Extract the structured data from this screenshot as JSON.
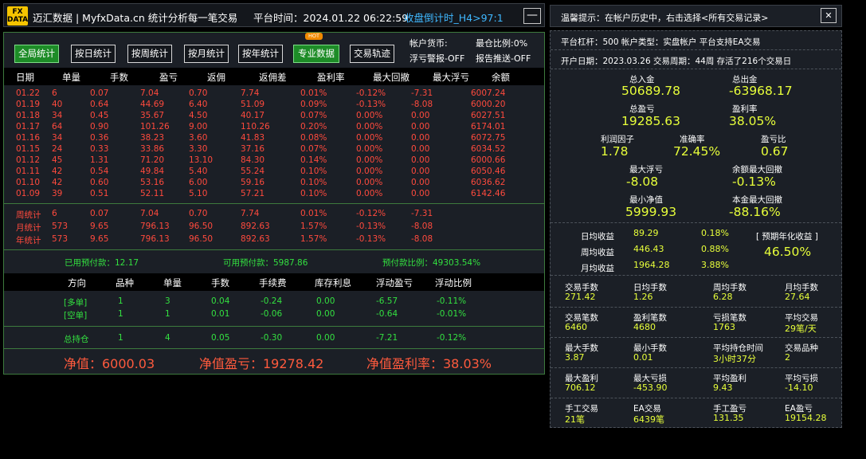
{
  "title_bar": {
    "logo_top": "FX",
    "logo_bottom": "DATA",
    "app_title": "迈汇数据 | MyfxData.cn  统计分析每一笔交易",
    "platform_time": "平台时间：2024.01.22 06:22:59",
    "countdown": "收盘倒计时_H4>97:1",
    "minimize_label": "—"
  },
  "toolbar": {
    "buttons": [
      "全局统计",
      "按日统计",
      "按周统计",
      "按月统计",
      "按年统计",
      "专业数据",
      "交易轨迹"
    ],
    "hot_badge": "HOT",
    "currency": "帐户货币:",
    "position_ratio": "最仓比例:0%",
    "float_alert": "浮亏警报-OFF",
    "report_push": "报告推送-OFF"
  },
  "daily_table": {
    "headers": [
      "日期",
      "单量",
      "手数",
      "盈亏",
      "返佣",
      "返佣差",
      "盈利率",
      "最大回撤",
      "最大浮亏",
      "余额"
    ],
    "rows": [
      [
        "01.22",
        "6",
        "0.07",
        "7.04",
        "0.70",
        "7.74",
        "0.01%",
        "-0.12%",
        "-7.31",
        "6007.24"
      ],
      [
        "01.19",
        "40",
        "0.64",
        "44.69",
        "6.40",
        "51.09",
        "0.09%",
        "-0.13%",
        "-8.08",
        "6000.20"
      ],
      [
        "01.18",
        "34",
        "0.45",
        "35.67",
        "4.50",
        "40.17",
        "0.07%",
        "0.00%",
        "0.00",
        "6027.51"
      ],
      [
        "01.17",
        "64",
        "0.90",
        "101.26",
        "9.00",
        "110.26",
        "0.20%",
        "0.00%",
        "0.00",
        "6174.01"
      ],
      [
        "01.16",
        "34",
        "0.36",
        "38.23",
        "3.60",
        "41.83",
        "0.08%",
        "0.00%",
        "0.00",
        "6072.75"
      ],
      [
        "01.15",
        "24",
        "0.33",
        "33.86",
        "3.30",
        "37.16",
        "0.07%",
        "0.00%",
        "0.00",
        "6034.52"
      ],
      [
        "01.12",
        "45",
        "1.31",
        "71.20",
        "13.10",
        "84.30",
        "0.14%",
        "0.00%",
        "0.00",
        "6000.66"
      ],
      [
        "01.11",
        "42",
        "0.54",
        "49.84",
        "5.40",
        "55.24",
        "0.10%",
        "0.00%",
        "0.00",
        "6050.46"
      ],
      [
        "01.10",
        "42",
        "0.60",
        "53.16",
        "6.00",
        "59.16",
        "0.10%",
        "0.00%",
        "0.00",
        "6036.62"
      ],
      [
        "01.09",
        "39",
        "0.51",
        "52.11",
        "5.10",
        "57.21",
        "0.10%",
        "0.00%",
        "0.00",
        "6142.46"
      ]
    ],
    "summary": [
      [
        "周统计",
        "6",
        "0.07",
        "7.04",
        "0.70",
        "7.74",
        "0.01%",
        "-0.12%",
        "-7.31"
      ],
      [
        "月统计",
        "573",
        "9.65",
        "796.13",
        "96.50",
        "892.63",
        "1.57%",
        "-0.13%",
        "-8.08"
      ],
      [
        "年统计",
        "573",
        "9.65",
        "796.13",
        "96.50",
        "892.63",
        "1.57%",
        "-0.13%",
        "-8.08"
      ]
    ]
  },
  "deposit": {
    "used": "已用预付款：12.17",
    "available": "可用预付款：5987.86",
    "ratio": "预付款比例：49303.54%"
  },
  "positions": {
    "headers": [
      "方向",
      "品种",
      "单量",
      "手数",
      "手续费",
      "库存利息",
      "浮动盈亏",
      "浮动比例"
    ],
    "rows": [
      [
        "[多单]",
        "1",
        "3",
        "0.04",
        "-0.24",
        "0.00",
        "-6.57",
        "-0.11%"
      ],
      [
        "[空单]",
        "1",
        "1",
        "0.01",
        "-0.06",
        "0.00",
        "-0.64",
        "-0.01%"
      ]
    ],
    "total": [
      "总持仓",
      "1",
      "4",
      "0.05",
      "-0.30",
      "0.00",
      "-7.21",
      "-0.12%"
    ]
  },
  "net": {
    "equity": "净值：6000.03",
    "net_profit": "净值盈亏：19278.42",
    "net_profit_rate": "净值盈利率：38.03%"
  },
  "tip_bar": {
    "text": "温馨提示：在帐户历史中，右击选择<所有交易记录>",
    "close_label": "✕"
  },
  "account": {
    "line1": "平台杠杆：500    帐户类型：实盘帐户    平台支持EA交易",
    "line2": "开户日期：2023.03.26    交易周期：44周    存活了216个交易日"
  },
  "stats": {
    "total_deposit_label": "总入金",
    "total_deposit": "50689.78",
    "total_withdraw_label": "总出金",
    "total_withdraw": "-63968.17",
    "total_pl_label": "总盈亏",
    "total_pl": "19285.63",
    "profit_rate_label": "盈利率",
    "profit_rate": "38.05%",
    "profit_factor_label": "利润因子",
    "profit_factor": "1.78",
    "accuracy_label": "准确率",
    "accuracy": "72.45%",
    "pl_ratio_label": "盈亏比",
    "pl_ratio": "0.67",
    "max_float_label": "最大浮亏",
    "max_float": "-8.08",
    "balance_dd_label": "余额最大回撤",
    "balance_dd": "-0.13%",
    "min_equity_label": "最小净值",
    "min_equity": "5999.93",
    "principal_dd_label": "本金最大回撤",
    "principal_dd": "-88.16%"
  },
  "returns": {
    "daily_label": "日均收益",
    "daily_val": "89.29",
    "daily_pct": "0.18%",
    "weekly_label": "周均收益",
    "weekly_val": "446.43",
    "weekly_pct": "0.88%",
    "monthly_label": "月均收益",
    "monthly_val": "1964.28",
    "monthly_pct": "3.88%",
    "annual_label": "[ 预期年化收益 ]",
    "annual_val": "46.50%"
  },
  "trade_stats": {
    "lots_labels": [
      "交易手数",
      "日均手数",
      "周均手数",
      "月均手数"
    ],
    "lots_values": [
      "271.42",
      "1.26",
      "6.28",
      "27.64"
    ],
    "count_labels": [
      "交易笔数",
      "盈利笔数",
      "亏损笔数",
      "平均交易"
    ],
    "count_values": [
      "6460",
      "4680",
      "1763",
      "29笔/天"
    ],
    "misc_labels": [
      "最大手数",
      "最小手数",
      "平均持仓时间",
      "交易品种"
    ],
    "misc_values": [
      "3.87",
      "0.01",
      "3小时37分",
      "2"
    ],
    "profit_labels": [
      "最大盈利",
      "最大亏损",
      "平均盈利",
      "平均亏损"
    ],
    "profit_values": [
      "706.12",
      "-453.90",
      "9.43",
      "-14.10"
    ],
    "ea_labels": [
      "手工交易",
      "EA交易",
      "手工盈亏",
      "EA盈亏"
    ],
    "ea_values": [
      "21笔",
      "6439笔",
      "131.35",
      "19154.28"
    ]
  }
}
